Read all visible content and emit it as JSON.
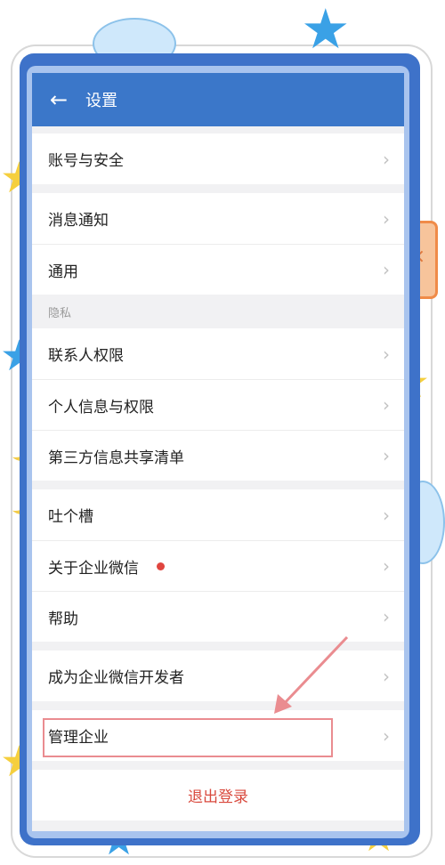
{
  "header": {
    "title": "设置",
    "back_icon": "back-arrow-icon"
  },
  "groups": [
    {
      "items": [
        {
          "label": "账号与安全"
        }
      ]
    },
    {
      "items": [
        {
          "label": "消息通知"
        },
        {
          "label": "通用"
        }
      ]
    },
    {
      "section": "隐私",
      "items": [
        {
          "label": "联系人权限"
        },
        {
          "label": "个人信息与权限"
        },
        {
          "label": "第三方信息共享清单"
        }
      ]
    },
    {
      "items": [
        {
          "label": "吐个槽"
        },
        {
          "label": "关于企业微信",
          "badge": "red-dot"
        },
        {
          "label": "帮助"
        }
      ]
    },
    {
      "items": [
        {
          "label": "成为企业微信开发者"
        }
      ]
    },
    {
      "items": [
        {
          "label": "管理企业",
          "highlighted": true
        }
      ]
    }
  ],
  "logout": {
    "label": "退出登录"
  },
  "colors": {
    "titlebar": "#3b77c9",
    "badge": "#e0453f",
    "logout_text": "#d94a3e",
    "annotation": "#ea8c90"
  }
}
